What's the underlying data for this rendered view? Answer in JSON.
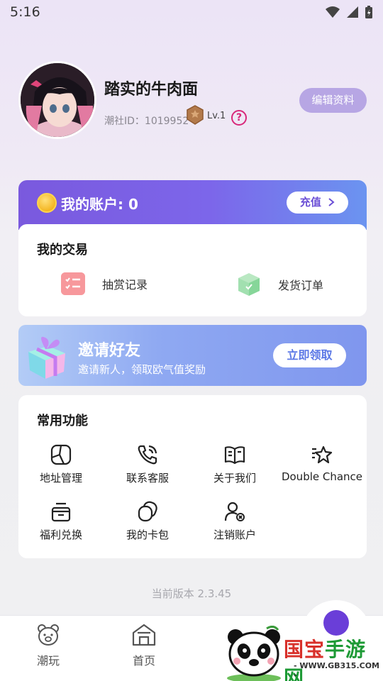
{
  "status_bar": {
    "time": "5:16"
  },
  "profile": {
    "username": "踏实的牛肉面",
    "id_text": "潮社ID：1019952",
    "level": "Lv.1",
    "help_glyph": "?",
    "edit_button": "编辑资料"
  },
  "account": {
    "label": "我的账户: 0",
    "recharge_button": "充值"
  },
  "trade": {
    "title": "我的交易",
    "items": [
      {
        "label": "抽赏记录",
        "icon": "list-icon"
      },
      {
        "label": "发货订单",
        "icon": "package-icon"
      }
    ]
  },
  "invite": {
    "title": "邀请好友",
    "subtitle": "邀请新人，领取欧气值奖励",
    "button": "立即领取"
  },
  "functions": {
    "title": "常用功能",
    "items": [
      {
        "label": "地址管理",
        "icon": "map-icon"
      },
      {
        "label": "联系客服",
        "icon": "phone-icon"
      },
      {
        "label": "关于我们",
        "icon": "book-icon"
      },
      {
        "label": "Double Chance",
        "icon": "star-icon"
      },
      {
        "label": "福利兑换",
        "icon": "gift-box-icon"
      },
      {
        "label": "我的卡包",
        "icon": "cards-icon"
      },
      {
        "label": "注销账户",
        "icon": "user-remove-icon"
      }
    ]
  },
  "version": "当前版本 2.3.45",
  "bottom_nav": {
    "items": [
      {
        "label": "潮玩",
        "icon": "bear-icon"
      },
      {
        "label": "首页",
        "icon": "home-icon"
      }
    ]
  },
  "watermark": {
    "text_a": "国宝",
    "text_b": "手游网",
    "url": "- WWW.GB315.COM -"
  },
  "colors": {
    "accent_purple": "#7a59de",
    "edit_button_bg": "#b7a6e4",
    "help_pink": "#d8287a",
    "invite_blue": "#8fa9f2"
  }
}
